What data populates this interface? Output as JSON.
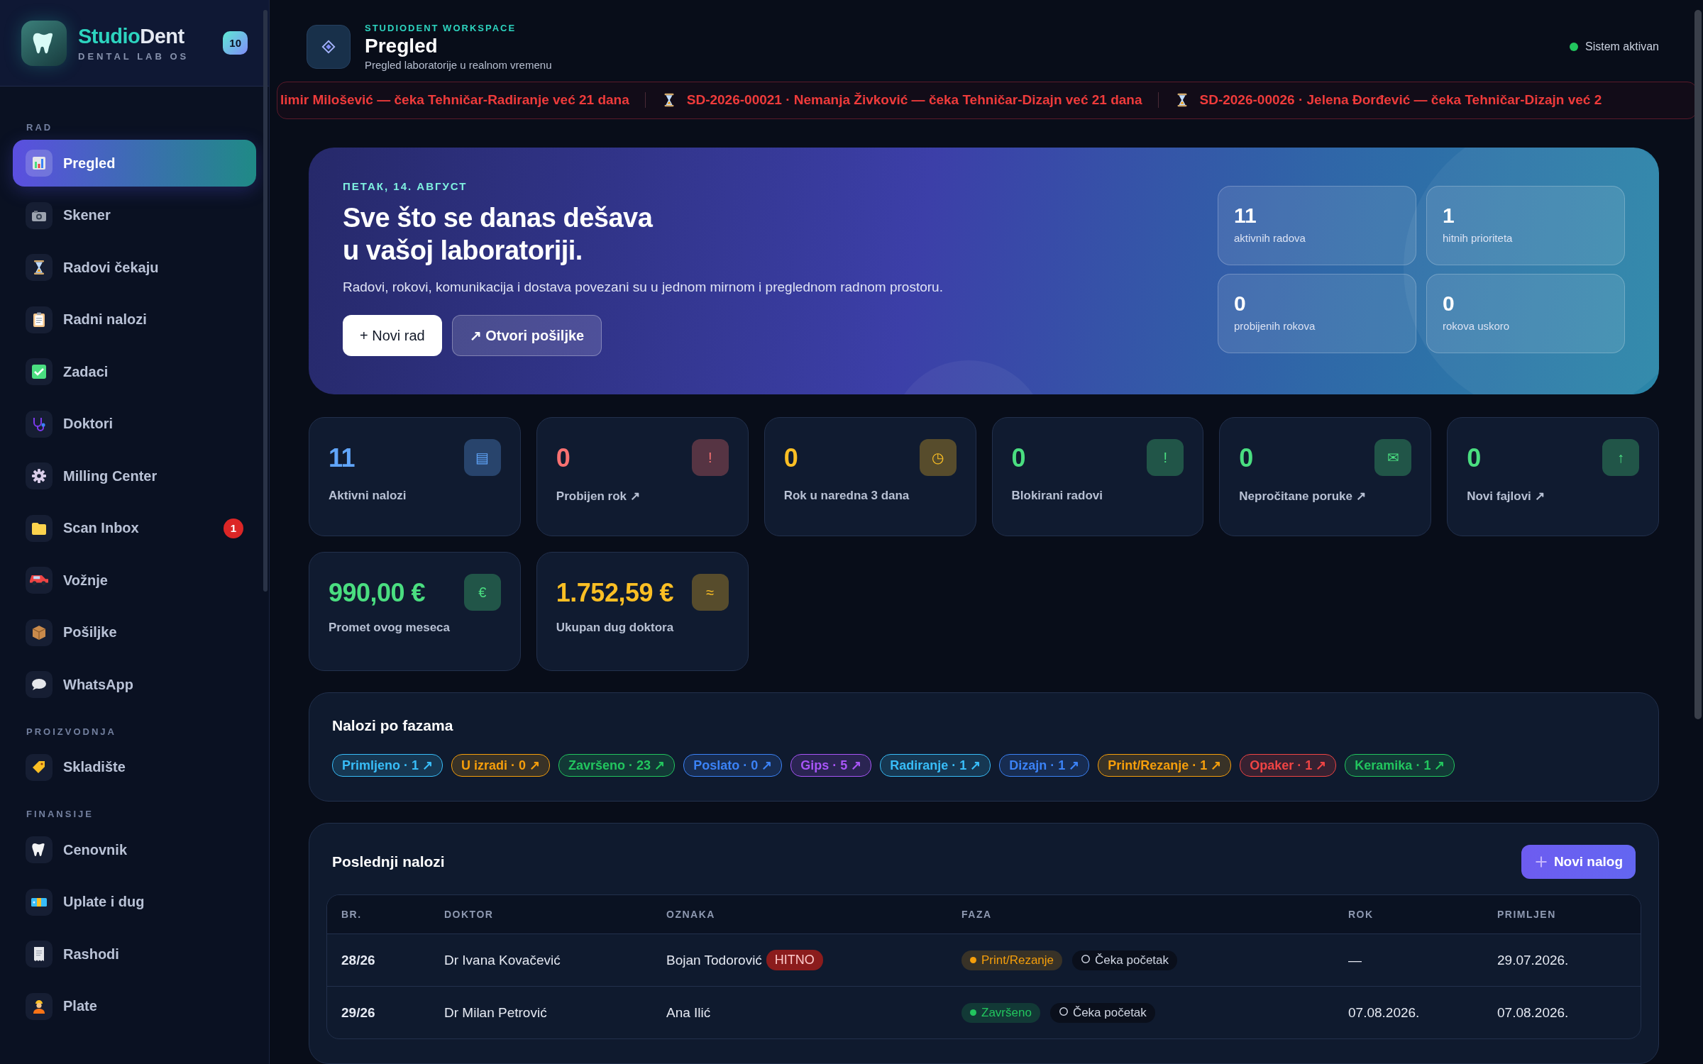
{
  "sidebar": {
    "brand": {
      "name_first": "Studio",
      "name_second": "Dent",
      "subtitle": "DENTAL LAB OS",
      "badge": "10"
    },
    "sections": [
      {
        "label": "RAD",
        "items": [
          {
            "label": "Pregled",
            "selected": true
          },
          {
            "label": "Skener",
            "selected": false
          },
          {
            "label": "Radovi čekaju",
            "selected": false
          },
          {
            "label": "Radni nalozi",
            "selected": false
          },
          {
            "label": "Zadaci",
            "selected": false
          },
          {
            "label": "Doktori",
            "selected": false
          },
          {
            "label": "Milling Center",
            "selected": false
          },
          {
            "label": "Scan Inbox",
            "selected": false,
            "badge": "1"
          },
          {
            "label": "Vožnje",
            "selected": false
          },
          {
            "label": "Pošiljke",
            "selected": false
          },
          {
            "label": "WhatsApp",
            "selected": false
          }
        ]
      },
      {
        "label": "PROIZVODNJA",
        "items": [
          {
            "label": "Skladište",
            "selected": false
          }
        ]
      },
      {
        "label": "FINANSIJE",
        "items": [
          {
            "label": "Cenovnik",
            "selected": false
          },
          {
            "label": "Uplate i dug",
            "selected": false
          },
          {
            "label": "Rashodi",
            "selected": false
          },
          {
            "label": "Plate",
            "selected": false
          }
        ]
      }
    ]
  },
  "header": {
    "eyebrow": "STUDIODENT WORKSPACE",
    "title": "Pregled",
    "subtitle": "Pregled laboratorije u realnom vremenu",
    "status": {
      "label": "Sistem aktivan",
      "on": true
    }
  },
  "ticker": [
    {
      "text": "limir Milošević — čeka Tehničar-Radiranje već 21 dana",
      "show_icon": false
    },
    {
      "text": "SD-2026-00021 · Nemanja Živković — čeka Tehničar-Dizajn već 21 dana",
      "show_icon": true
    },
    {
      "text": "SD-2026-00026 · Jelena Đorđević — čeka Tehničar-Dizajn već 2",
      "show_icon": true
    }
  ],
  "hero": {
    "date": "ПЕТАК, 14. АВГУСТ",
    "heading_lines": [
      "Sve što se danas dešava",
      "u vašoj laboratoriji."
    ],
    "text": "Radovi, rokovi, komunikacija i dostava povezani su u jednom mirnom i preglednom radnom prostoru.",
    "buttons": [
      {
        "label": "+  Novi rad",
        "kind": "primary"
      },
      {
        "label": "↗ Otvori pošiljke",
        "kind": "secondary"
      }
    ],
    "tiles": [
      {
        "value": "11",
        "label": "aktivnih radova"
      },
      {
        "value": "1",
        "label": "hitnih prioriteta"
      },
      {
        "value": "0",
        "label": "probijenih rokova"
      },
      {
        "value": "0",
        "label": "rokova uskoro"
      }
    ]
  },
  "stats": [
    {
      "value": "11",
      "label": "Aktivni nalozi",
      "icon": "▤",
      "color": "#60a5fa"
    },
    {
      "value": "0",
      "label": "Probijen rok ↗",
      "icon": "!",
      "color": "#f87171"
    },
    {
      "value": "0",
      "label": "Rok u naredna 3 dana",
      "icon": "◷",
      "color": "#fbbf24"
    },
    {
      "value": "0",
      "label": "Blokirani radovi",
      "icon": "!",
      "color": "#4ade80"
    },
    {
      "value": "0",
      "label": "Nepročitane poruke ↗",
      "icon": "✉",
      "color": "#4ade80"
    },
    {
      "value": "0",
      "label": "Novi fajlovi ↗",
      "icon": "↑",
      "color": "#4ade80"
    },
    {
      "value": "990,00 €",
      "label": "Promet ovog meseca",
      "icon": "€",
      "color": "#4ade80"
    },
    {
      "value": "1.752,59 €",
      "label": "Ukupan dug doktora",
      "icon": "≈",
      "color": "#fbbf24"
    }
  ],
  "phases": {
    "title": "Nalozi po fazama",
    "chips": [
      {
        "label": "Primljeno · 1 ↗",
        "color": "#38bdf8"
      },
      {
        "label": "U izradi · 0 ↗",
        "color": "#f59e0b"
      },
      {
        "label": "Završeno · 23 ↗",
        "color": "#22c55e"
      },
      {
        "label": "Poslato · 0 ↗",
        "color": "#3b82f6"
      },
      {
        "label": "Gips · 5 ↗",
        "color": "#a855f7"
      },
      {
        "label": "Radiranje · 1 ↗",
        "color": "#38bdf8"
      },
      {
        "label": "Dizajn · 1 ↗",
        "color": "#3b82f6"
      },
      {
        "label": "Print/Rezanje · 1 ↗",
        "color": "#f59e0b"
      },
      {
        "label": "Opaker · 1 ↗",
        "color": "#ef4444"
      },
      {
        "label": "Keramika · 1 ↗",
        "color": "#22c55e"
      }
    ]
  },
  "orders": {
    "title": "Poslednji nalozi",
    "button": "Novi nalog",
    "columns": [
      "BR.",
      "DOKTOR",
      "OZNAKA",
      "FAZA",
      "ROK",
      "PRIMLJEN"
    ],
    "rows": [
      {
        "number": "28/26",
        "doctor": "Dr Ivana Kovačević",
        "label": "Bojan Todorović",
        "urgent": "HITNO",
        "phase": {
          "label": "Print/Rezanje",
          "color": "#f59e0b"
        },
        "status": "Čeka početak",
        "due": "—",
        "received": "29.07.2026."
      },
      {
        "number": "29/26",
        "doctor": "Dr Milan Petrović",
        "label": "Ana Ilić",
        "phase": {
          "label": "Završeno",
          "color": "#22c55e"
        },
        "status": "Čeka početak",
        "due": "07.08.2026.",
        "received": "07.08.2026."
      }
    ]
  }
}
